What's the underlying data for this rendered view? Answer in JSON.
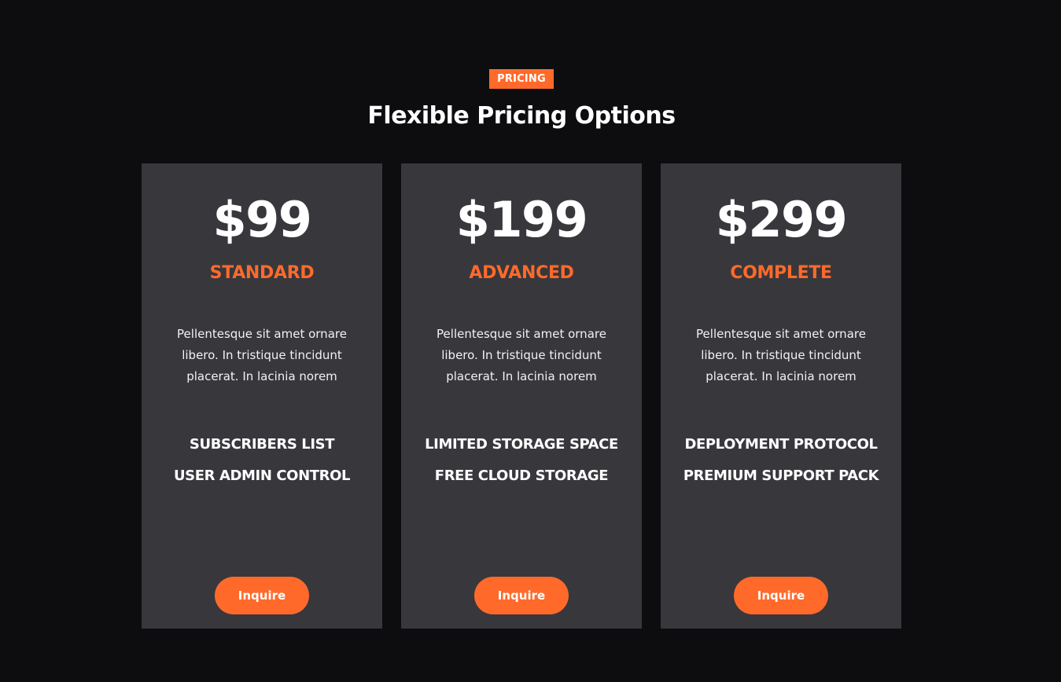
{
  "header": {
    "badge": "PRICING",
    "title": "Flexible Pricing Options"
  },
  "colors": {
    "accent": "#ff6a2b",
    "background": "#0d0d0f",
    "card": "#38373c",
    "text": "#ffffff"
  },
  "plans": [
    {
      "price": "$99",
      "name": "STANDARD",
      "description": "Pellentesque sit amet ornare libero. In tristique tincidunt placerat. In lacinia norem",
      "features": [
        "SUBSCRIBERS LIST",
        "USER ADMIN CONTROL"
      ],
      "button_label": "Inquire"
    },
    {
      "price": "$199",
      "name": "ADVANCED",
      "description": "Pellentesque sit amet ornare libero. In tristique tincidunt placerat. In lacinia norem",
      "features": [
        "LIMITED STORAGE SPACE",
        "FREE CLOUD STORAGE"
      ],
      "button_label": "Inquire"
    },
    {
      "price": "$299",
      "name": "COMPLETE",
      "description": "Pellentesque sit amet ornare libero. In tristique tincidunt placerat. In lacinia norem",
      "features": [
        "DEPLOYMENT PROTOCOL",
        "PREMIUM SUPPORT PACK"
      ],
      "button_label": "Inquire"
    }
  ]
}
